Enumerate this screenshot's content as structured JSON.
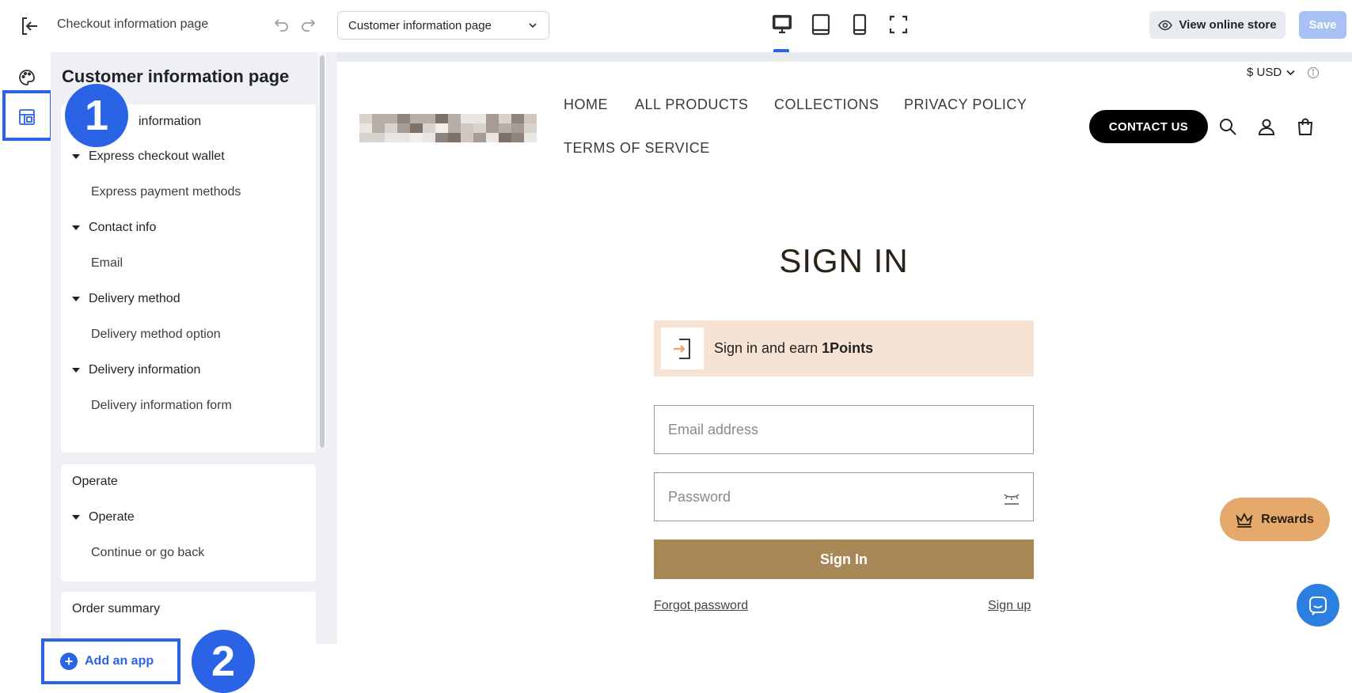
{
  "topbar": {
    "page_name": "Checkout information page",
    "page_select": "Customer information page",
    "view_store_label": "View online store",
    "save_label": "Save",
    "devices": [
      "desktop-icon",
      "tablet-icon",
      "mobile-icon",
      "fullscreen-icon"
    ],
    "active_device": "desktop"
  },
  "panel": {
    "title": "Customer information page",
    "card1": {
      "header": "information",
      "items": [
        {
          "label": "Express checkout wallet",
          "type": "parent"
        },
        {
          "label": "Express payment methods",
          "type": "child"
        },
        {
          "label": "Contact info",
          "type": "parent"
        },
        {
          "label": "Email",
          "type": "child"
        },
        {
          "label": "Delivery method",
          "type": "parent"
        },
        {
          "label": "Delivery method option",
          "type": "child"
        },
        {
          "label": "Delivery information",
          "type": "parent"
        },
        {
          "label": "Delivery information form",
          "type": "child"
        }
      ]
    },
    "card2": {
      "header": "Operate",
      "items": [
        {
          "label": "Operate",
          "type": "parent"
        },
        {
          "label": "Continue or go back",
          "type": "child"
        }
      ]
    },
    "card3": {
      "header": "Order summary"
    }
  },
  "add_app_label": "Add an app",
  "callouts": [
    "1",
    "2"
  ],
  "store": {
    "currency": "$ USD",
    "nav": [
      "HOME",
      "ALL PRODUCTS",
      "COLLECTIONS",
      "PRIVACY POLICY",
      "TERMS OF SERVICE"
    ],
    "contact_label": "CONTACT US",
    "signin_title": "SIGN IN",
    "earn_prefix": "Sign in and earn ",
    "earn_points": "1Points",
    "email_placeholder": "Email address",
    "password_placeholder": "Password",
    "signin_button": "Sign In",
    "forgot_label": "Forgot password",
    "signup_label": "Sign up",
    "rewards_label": "Rewards"
  },
  "colors": {
    "accent": "#2b63e6",
    "signin_button": "#a78856",
    "earn_banner": "#f6e3d3",
    "rewards": "#e4a96b"
  }
}
